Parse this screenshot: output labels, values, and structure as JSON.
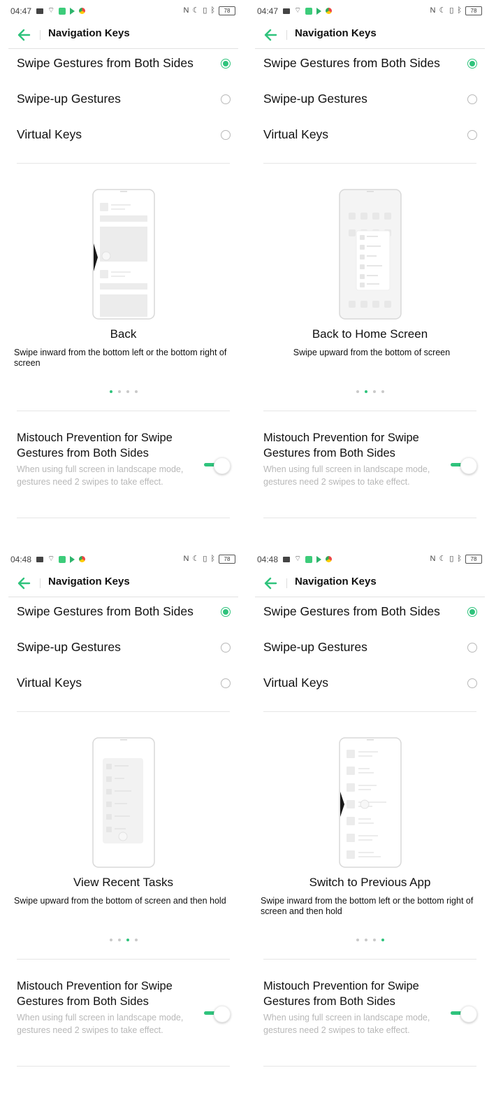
{
  "panels": [
    {
      "status": {
        "time": "04:47",
        "battery": "78"
      },
      "header": {
        "title": "Navigation Keys"
      },
      "options": [
        {
          "label": "Swipe Gestures from Both Sides",
          "selected": true
        },
        {
          "label": "Swipe-up Gestures",
          "selected": false
        },
        {
          "label": "Virtual Keys",
          "selected": false
        }
      ],
      "gesture": {
        "title": "Back",
        "description": "Swipe inward from the bottom left or the bottom right of screen",
        "page_index": 0,
        "page_count": 4
      },
      "mistouch": {
        "title": "Mistouch Prevention for Swipe Gestures from Both Sides",
        "description": "When using full screen in landscape mode, gestures need 2 swipes to take effect.",
        "enabled": true
      }
    },
    {
      "status": {
        "time": "04:47",
        "battery": "78"
      },
      "header": {
        "title": "Navigation Keys"
      },
      "options": [
        {
          "label": "Swipe Gestures from Both Sides",
          "selected": true
        },
        {
          "label": "Swipe-up Gestures",
          "selected": false
        },
        {
          "label": "Virtual Keys",
          "selected": false
        }
      ],
      "gesture": {
        "title": "Back to Home Screen",
        "description": "Swipe upward from the bottom of screen",
        "page_index": 1,
        "page_count": 4
      },
      "mistouch": {
        "title": "Mistouch Prevention for Swipe Gestures from Both Sides",
        "description": "When using full screen in landscape mode, gestures need 2 swipes to take effect.",
        "enabled": true
      }
    },
    {
      "status": {
        "time": "04:48",
        "battery": "78"
      },
      "header": {
        "title": "Navigation Keys"
      },
      "options": [
        {
          "label": "Swipe Gestures from Both Sides",
          "selected": true
        },
        {
          "label": "Swipe-up Gestures",
          "selected": false
        },
        {
          "label": "Virtual Keys",
          "selected": false
        }
      ],
      "gesture": {
        "title": "View Recent Tasks",
        "description": "Swipe upward from the bottom of screen and then hold",
        "page_index": 2,
        "page_count": 4
      },
      "mistouch": {
        "title": "Mistouch Prevention for Swipe Gestures from Both Sides",
        "description": "When using full screen in landscape mode, gestures need 2 swipes to take effect.",
        "enabled": true
      }
    },
    {
      "status": {
        "time": "04:48",
        "battery": "78"
      },
      "header": {
        "title": "Navigation Keys"
      },
      "options": [
        {
          "label": "Swipe Gestures from Both Sides",
          "selected": true
        },
        {
          "label": "Swipe-up Gestures",
          "selected": false
        },
        {
          "label": "Virtual Keys",
          "selected": false
        }
      ],
      "gesture": {
        "title": "Switch to Previous App",
        "description": "Swipe inward from the bottom left or the bottom right of screen and then hold",
        "page_index": 3,
        "page_count": 4
      },
      "mistouch": {
        "title": "Mistouch Prevention for Swipe Gestures from Both Sides",
        "description": "When using full screen in landscape mode, gestures need 2 swipes to take effect.",
        "enabled": true
      }
    }
  ],
  "theme": {
    "accent": "#2fc37c",
    "divider": "#e6e6e6",
    "muted_text": "#b8b8b8"
  }
}
